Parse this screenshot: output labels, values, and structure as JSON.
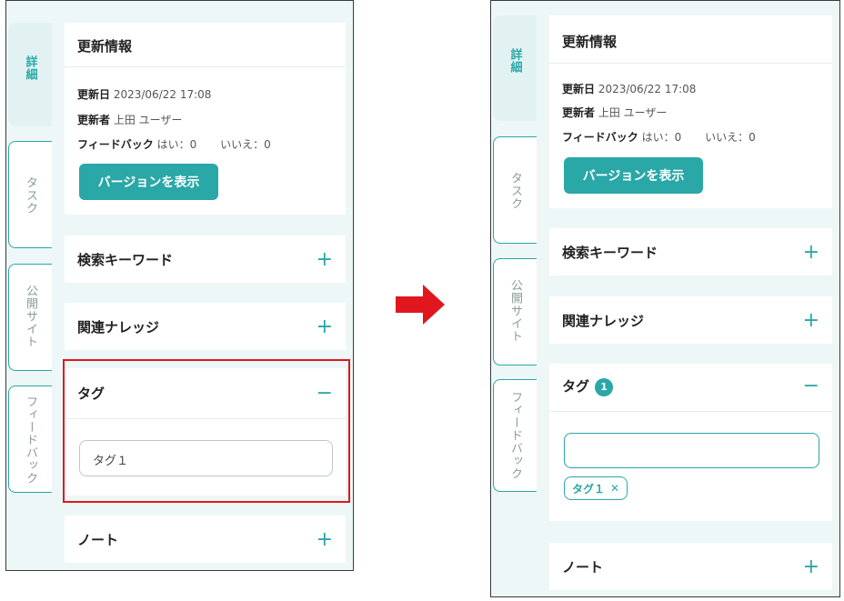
{
  "tabs": {
    "details": "詳細",
    "tasks": "タスク",
    "public_site": "公開サイト",
    "feedback": "フィードバック"
  },
  "update_info": {
    "title": "更新情報",
    "updated_date_label": "更新日",
    "updated_date_value": "2023/06/22 17:08",
    "updated_by_label": "更新者",
    "updated_by_value": "上田 ユーザー",
    "feedback_label": "フィードバック",
    "feedback_yes": "はい：0",
    "feedback_no": "いいえ：0",
    "version_button": "バージョンを表示"
  },
  "sections": {
    "search_keywords": "検索キーワード",
    "related_knowledge": "関連ナレッジ",
    "tags": "タグ",
    "notes": "ノート"
  },
  "before": {
    "tag_input_value": "タグ１"
  },
  "after": {
    "tag_count": "1",
    "tag_input_value": "",
    "tag_chip": "タグ１"
  },
  "icons": {
    "expand": "+",
    "collapse": "−",
    "remove": "✕"
  },
  "colors": {
    "accent": "#2aa7a7",
    "highlight": "#e0171f",
    "arrow": "#e0171f"
  }
}
